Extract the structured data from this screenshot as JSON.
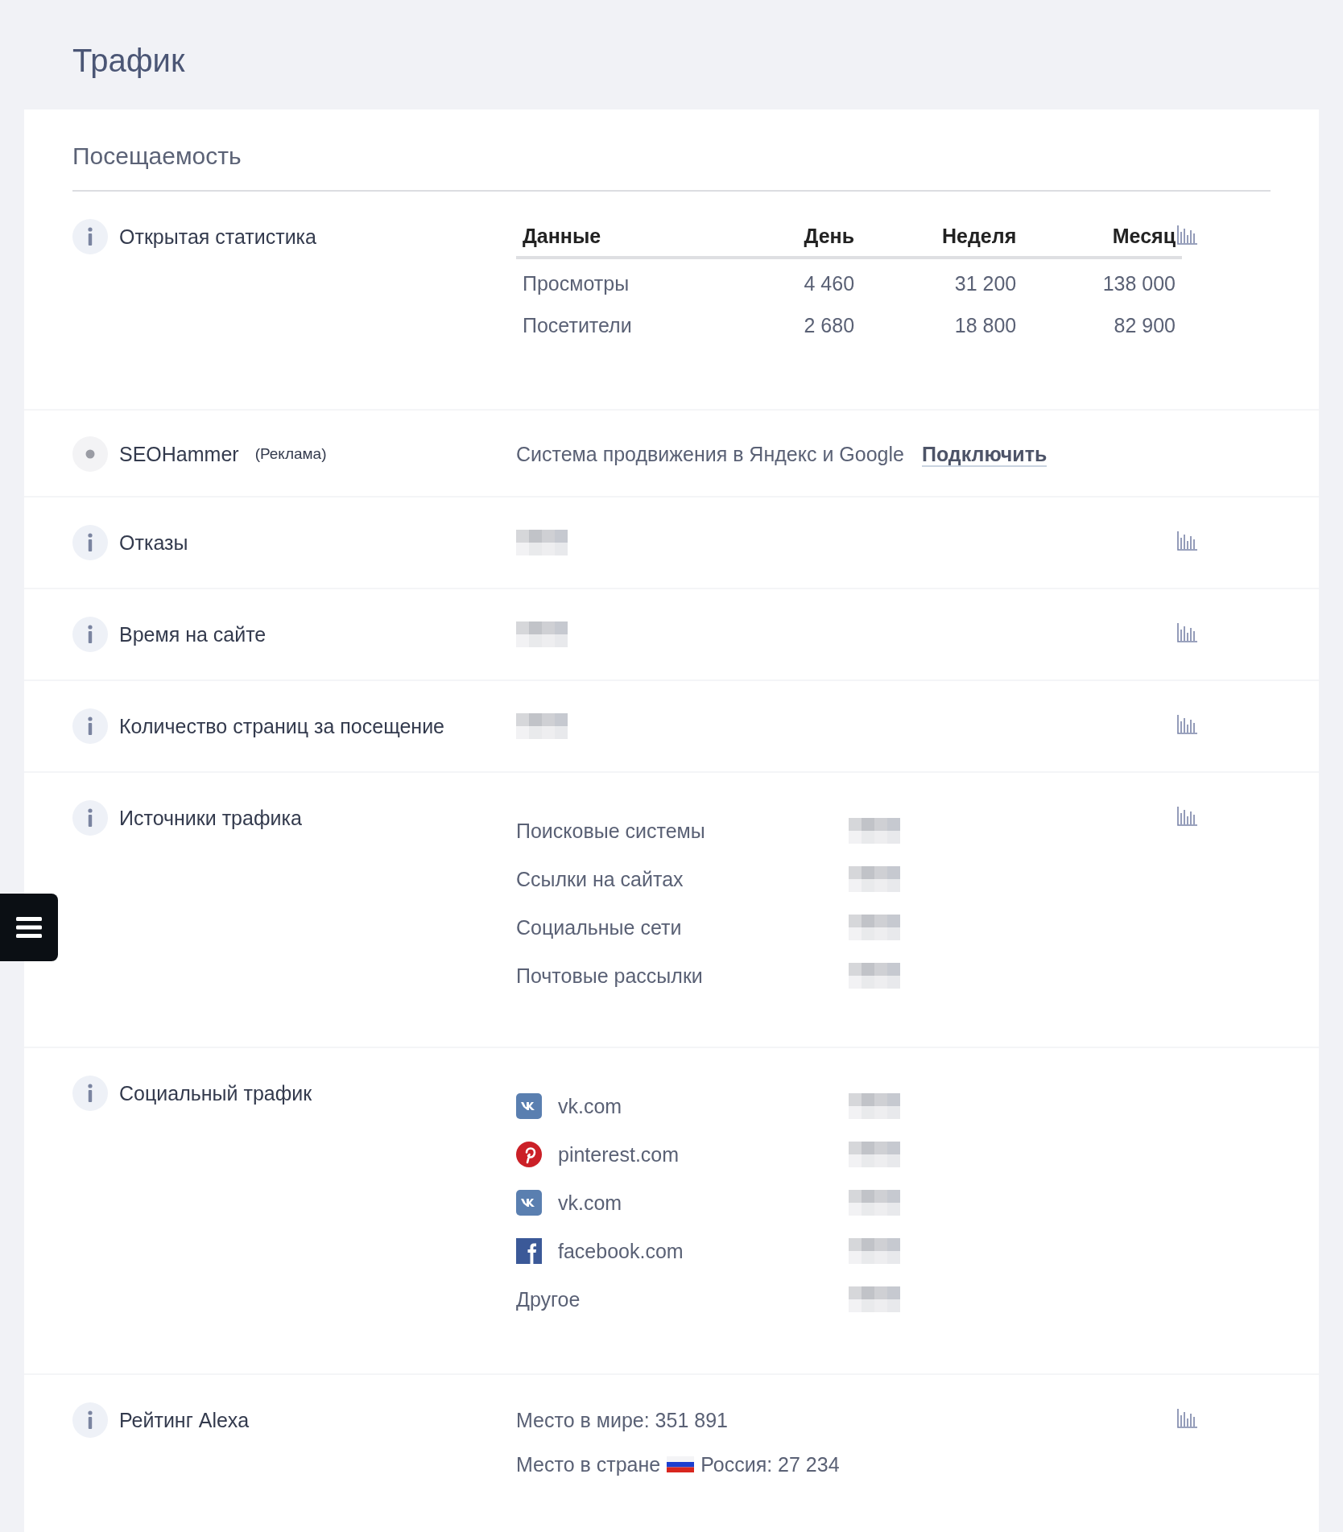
{
  "page_title": "Трафик",
  "section": {
    "title": "Посещаемость",
    "rows": [
      {
        "kind": "table",
        "label": "Открытая статистика",
        "chart": true,
        "columns": [
          "Данные",
          "День",
          "Неделя",
          "Месяц"
        ],
        "rows": [
          [
            "Просмотры",
            "4 460",
            "31 200",
            "138 000"
          ],
          [
            "Посетители",
            "2 680",
            "18 800",
            "82 900"
          ]
        ]
      },
      {
        "kind": "ad",
        "label": "SEOHammer",
        "note": "(Реклама)",
        "chart": false,
        "text": "Система продвижения в Яндекс и Google",
        "link": "Подключить"
      },
      {
        "kind": "hidden",
        "label": "Отказы",
        "chart": true
      },
      {
        "kind": "hidden",
        "label": "Время на сайте",
        "chart": true
      },
      {
        "kind": "hidden",
        "label": "Количество страниц за посещение",
        "chart": true
      },
      {
        "kind": "list",
        "label": "Источники трафика",
        "chart": true,
        "items": [
          {
            "name": "Поисковые системы",
            "kind": "plain"
          },
          {
            "name": "Ссылки на сайтах",
            "kind": "plain"
          },
          {
            "name": "Социальные сети",
            "kind": "plain"
          },
          {
            "name": "Почтовые рассылки",
            "kind": "plain"
          }
        ]
      },
      {
        "kind": "list",
        "label": "Социальный трафик",
        "chart": false,
        "items": [
          {
            "name": "vk.com",
            "kind": "vk"
          },
          {
            "name": "pinterest.com",
            "kind": "pinterest"
          },
          {
            "name": "vk.com",
            "kind": "vk"
          },
          {
            "name": "facebook.com",
            "kind": "facebook"
          },
          {
            "name": "Другое",
            "kind": "plain"
          }
        ]
      },
      {
        "kind": "rank",
        "label": "Рейтинг Alexa",
        "chart": true,
        "lines": [
          {
            "kind": "plain",
            "text": "Место в мире: 351 891"
          },
          {
            "kind": "country",
            "prefix": "Место в стране",
            "text": "Россия: 27 234"
          }
        ]
      }
    ]
  }
}
